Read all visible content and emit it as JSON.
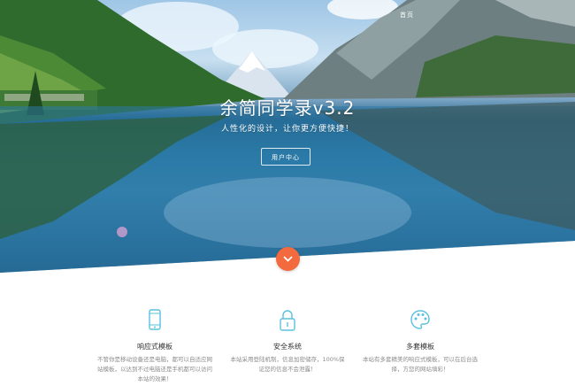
{
  "nav": {
    "home_label": "首页"
  },
  "hero": {
    "title": "余简同学录v3.2",
    "subtitle": "人性化的设计，让你更方便快捷！",
    "user_center_label": "用户中心"
  },
  "features": [
    {
      "title": "响应式模板",
      "desc": "不管你是移动设备还是电脑，都可以自适应网站模板，以达到不过电脑还是手机都可以访问本站的效果！",
      "icon": "mobile-icon"
    },
    {
      "title": "安全系统",
      "desc": "本站采用登陆机制，信息加密储存，100%保证您的信息不会泄露！",
      "icon": "lock-icon"
    },
    {
      "title": "多套模板",
      "desc": "本站有多套精美的响应式模板，可以在后台选择，方您的网站填彩！",
      "icon": "palette-icon"
    }
  ],
  "colors": {
    "accent": "#f26a3d",
    "icon_blue": "#5bc0de",
    "text_dark": "#333333",
    "text_muted": "#8c8c8c"
  }
}
